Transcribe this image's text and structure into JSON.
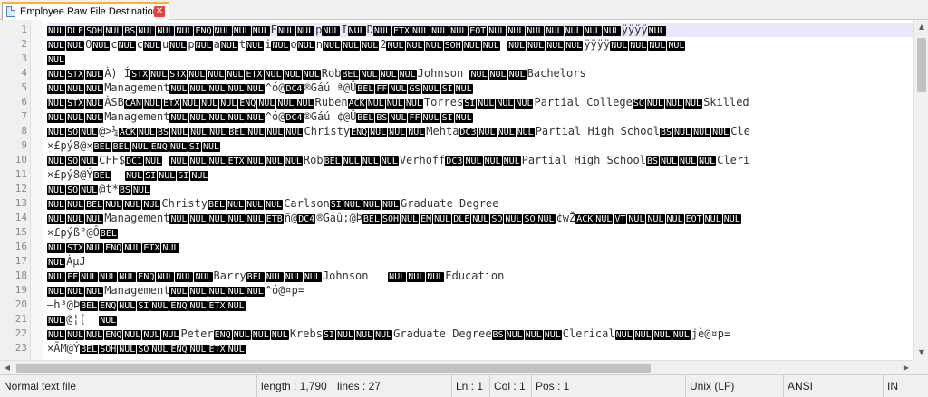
{
  "tab": {
    "title": "Employee Raw File Destination",
    "icon": "file-icon",
    "close_icon": "close-icon"
  },
  "editor": {
    "line_numbers": [
      "1",
      "2",
      "3",
      "4",
      "5",
      "6",
      "7",
      "8",
      "9",
      "10",
      "11",
      "12",
      "13",
      "14",
      "15",
      "16",
      "17",
      "18",
      "19",
      "20",
      "21",
      "22",
      "23"
    ],
    "lines": [
      [
        {
          "c": "NUL"
        },
        {
          "c": "DLE"
        },
        {
          "c": "SOH"
        },
        {
          "c": "NUL"
        },
        {
          "c": "BS"
        },
        {
          "c": "NUL"
        },
        {
          "c": "NUL"
        },
        {
          "c": "NUL"
        },
        {
          "c": "ENQ"
        },
        {
          "c": "NUL"
        },
        {
          "c": "NUL"
        },
        {
          "c": "NUL"
        },
        {
          "t": "E"
        },
        {
          "c": "NUL"
        },
        {
          "c": "NUL"
        },
        {
          "t": "p"
        },
        {
          "c": "NUL"
        },
        {
          "t": "I"
        },
        {
          "c": "NUL"
        },
        {
          "t": "D"
        },
        {
          "c": "NUL"
        },
        {
          "c": "ETX"
        },
        {
          "c": "NUL"
        },
        {
          "c": "NUL"
        },
        {
          "c": "NUL"
        },
        {
          "c": "EOT"
        },
        {
          "c": "NUL"
        },
        {
          "c": "NUL"
        },
        {
          "c": "NUL"
        },
        {
          "c": "NUL"
        },
        {
          "c": "NUL"
        },
        {
          "c": "NUL"
        },
        {
          "c": "NUL"
        },
        {
          "t": "ÿÿÿÿ"
        },
        {
          "c": "NUL"
        }
      ],
      [
        {
          "c": "NUL"
        },
        {
          "c": "NUL"
        },
        {
          "t": "O"
        },
        {
          "c": "NUL"
        },
        {
          "t": "c"
        },
        {
          "c": "NUL"
        },
        {
          "t": "c"
        },
        {
          "c": "NUL"
        },
        {
          "t": "u"
        },
        {
          "c": "NUL"
        },
        {
          "t": "p"
        },
        {
          "c": "NUL"
        },
        {
          "t": "a"
        },
        {
          "c": "NUL"
        },
        {
          "t": "t"
        },
        {
          "c": "NUL"
        },
        {
          "t": "i"
        },
        {
          "c": "NUL"
        },
        {
          "t": "o"
        },
        {
          "c": "NUL"
        },
        {
          "t": "n"
        },
        {
          "c": "NUL"
        },
        {
          "c": "NUL"
        },
        {
          "c": "NUL"
        },
        {
          "t": "2"
        },
        {
          "c": "NUL"
        },
        {
          "c": "NUL"
        },
        {
          "c": "NUL"
        },
        {
          "c": "SOH"
        },
        {
          "c": "NUL"
        },
        {
          "c": "NUL"
        },
        {
          "t": " "
        },
        {
          "c": "NUL"
        },
        {
          "c": "NUL"
        },
        {
          "c": "NUL"
        },
        {
          "c": "NUL"
        },
        {
          "t": "ÿÿÿÿ"
        },
        {
          "c": "NUL"
        },
        {
          "c": "NUL"
        },
        {
          "c": "NUL"
        },
        {
          "c": "NUL"
        }
      ],
      [
        {
          "c": "NUL"
        }
      ],
      [
        {
          "c": "NUL"
        },
        {
          "c": "STX"
        },
        {
          "c": "NUL"
        },
        {
          "t": "À) Í"
        },
        {
          "c": "STX"
        },
        {
          "c": "NUL"
        },
        {
          "c": "STX"
        },
        {
          "c": "NUL"
        },
        {
          "c": "NUL"
        },
        {
          "c": "NUL"
        },
        {
          "c": "ETX"
        },
        {
          "c": "NUL"
        },
        {
          "c": "NUL"
        },
        {
          "c": "NUL"
        },
        {
          "t": "Rob"
        },
        {
          "c": "BEL"
        },
        {
          "c": "NUL"
        },
        {
          "c": "NUL"
        },
        {
          "c": "NUL"
        },
        {
          "t": "Johnson "
        },
        {
          "c": "NUL"
        },
        {
          "c": "NUL"
        },
        {
          "c": "NUL"
        },
        {
          "t": "Bachelors"
        }
      ],
      [
        {
          "c": "NUL"
        },
        {
          "c": "NUL"
        },
        {
          "c": "NUL"
        },
        {
          "t": "Management"
        },
        {
          "c": "NUL"
        },
        {
          "c": "NUL"
        },
        {
          "c": "NUL"
        },
        {
          "c": "NUL"
        },
        {
          "c": "NUL"
        },
        {
          "t": "^ó@"
        },
        {
          "c": "DC4"
        },
        {
          "t": "®Gáú ª@Û"
        },
        {
          "c": "BEL"
        },
        {
          "c": "FF"
        },
        {
          "c": "NUL"
        },
        {
          "c": "GS"
        },
        {
          "c": "NUL"
        },
        {
          "c": "SI"
        },
        {
          "c": "NUL"
        }
      ],
      [
        {
          "c": "NUL"
        },
        {
          "c": "STX"
        },
        {
          "c": "NUL"
        },
        {
          "t": "ÀSB"
        },
        {
          "c": "CAN"
        },
        {
          "c": "NUL"
        },
        {
          "c": "ETX"
        },
        {
          "c": "NUL"
        },
        {
          "c": "NUL"
        },
        {
          "c": "NUL"
        },
        {
          "c": "ENQ"
        },
        {
          "c": "NUL"
        },
        {
          "c": "NUL"
        },
        {
          "c": "NUL"
        },
        {
          "t": "Ruben"
        },
        {
          "c": "ACK"
        },
        {
          "c": "NUL"
        },
        {
          "c": "NUL"
        },
        {
          "c": "NUL"
        },
        {
          "t": "Torres"
        },
        {
          "c": "SI"
        },
        {
          "c": "NUL"
        },
        {
          "c": "NUL"
        },
        {
          "c": "NUL"
        },
        {
          "t": "Partial College"
        },
        {
          "c": "SO"
        },
        {
          "c": "NUL"
        },
        {
          "c": "NUL"
        },
        {
          "c": "NUL"
        },
        {
          "t": "Skilled"
        }
      ],
      [
        {
          "c": "NUL"
        },
        {
          "c": "NUL"
        },
        {
          "c": "NUL"
        },
        {
          "t": "Management"
        },
        {
          "c": "NUL"
        },
        {
          "c": "NUL"
        },
        {
          "c": "NUL"
        },
        {
          "c": "NUL"
        },
        {
          "c": "NUL"
        },
        {
          "t": "^ó@"
        },
        {
          "c": "DC4"
        },
        {
          "t": "®Gáú ¢@Û"
        },
        {
          "c": "BEL"
        },
        {
          "c": "BS"
        },
        {
          "c": "NUL"
        },
        {
          "c": "FF"
        },
        {
          "c": "NUL"
        },
        {
          "c": "SI"
        },
        {
          "c": "NUL"
        }
      ],
      [
        {
          "c": "NUL"
        },
        {
          "c": "SO"
        },
        {
          "c": "NUL"
        },
        {
          "t": "@>¼"
        },
        {
          "c": "ACK"
        },
        {
          "c": "NUL"
        },
        {
          "c": "BS"
        },
        {
          "c": "NUL"
        },
        {
          "c": "NUL"
        },
        {
          "c": "NUL"
        },
        {
          "c": "BEL"
        },
        {
          "c": "NUL"
        },
        {
          "c": "NUL"
        },
        {
          "c": "NUL"
        },
        {
          "t": "Christy"
        },
        {
          "c": "ENQ"
        },
        {
          "c": "NUL"
        },
        {
          "c": "NUL"
        },
        {
          "c": "NUL"
        },
        {
          "t": "Mehta"
        },
        {
          "c": "DC3"
        },
        {
          "c": "NUL"
        },
        {
          "c": "NUL"
        },
        {
          "c": "NUL"
        },
        {
          "t": "Partial High School"
        },
        {
          "c": "BS"
        },
        {
          "c": "NUL"
        },
        {
          "c": "NUL"
        },
        {
          "c": "NUL"
        },
        {
          "t": "Cle"
        }
      ],
      [
        {
          "t": "×£pý8@×"
        },
        {
          "c": "BEL"
        },
        {
          "c": "BEL"
        },
        {
          "c": "NUL"
        },
        {
          "c": "ENQ"
        },
        {
          "c": "NUL"
        },
        {
          "c": "SI"
        },
        {
          "c": "NUL"
        }
      ],
      [
        {
          "c": "NUL"
        },
        {
          "c": "SO"
        },
        {
          "c": "NUL"
        },
        {
          "t": "CFF$"
        },
        {
          "c": "DC1"
        },
        {
          "c": "NUL"
        },
        {
          "t": " "
        },
        {
          "c": "NUL"
        },
        {
          "c": "NUL"
        },
        {
          "c": "NUL"
        },
        {
          "c": "ETX"
        },
        {
          "c": "NUL"
        },
        {
          "c": "NUL"
        },
        {
          "c": "NUL"
        },
        {
          "t": "Rob"
        },
        {
          "c": "BEL"
        },
        {
          "c": "NUL"
        },
        {
          "c": "NUL"
        },
        {
          "c": "NUL"
        },
        {
          "t": "Verhoff"
        },
        {
          "c": "DC3"
        },
        {
          "c": "NUL"
        },
        {
          "c": "NUL"
        },
        {
          "c": "NUL"
        },
        {
          "t": "Partial High School"
        },
        {
          "c": "BS"
        },
        {
          "c": "NUL"
        },
        {
          "c": "NUL"
        },
        {
          "c": "NUL"
        },
        {
          "t": "Cleri"
        }
      ],
      [
        {
          "t": "×£pý8@Ý"
        },
        {
          "c": "BEL"
        },
        {
          "t": "  "
        },
        {
          "c": "NUL"
        },
        {
          "c": "SI"
        },
        {
          "c": "NUL"
        },
        {
          "c": "SI"
        },
        {
          "c": "NUL"
        }
      ],
      [
        {
          "c": "NUL"
        },
        {
          "c": "SO"
        },
        {
          "c": "NUL"
        },
        {
          "t": "@t*"
        },
        {
          "c": "BS"
        },
        {
          "c": "NUL"
        }
      ],
      [
        {
          "c": "NUL"
        },
        {
          "c": "NUL"
        },
        {
          "c": "BEL"
        },
        {
          "c": "NUL"
        },
        {
          "c": "NUL"
        },
        {
          "c": "NUL"
        },
        {
          "t": "Christy"
        },
        {
          "c": "BEL"
        },
        {
          "c": "NUL"
        },
        {
          "c": "NUL"
        },
        {
          "c": "NUL"
        },
        {
          "t": "Carlson"
        },
        {
          "c": "SI"
        },
        {
          "c": "NUL"
        },
        {
          "c": "NUL"
        },
        {
          "c": "NUL"
        },
        {
          "t": "Graduate Degree"
        }
      ],
      [
        {
          "c": "NUL"
        },
        {
          "c": "NUL"
        },
        {
          "c": "NUL"
        },
        {
          "t": "Management"
        },
        {
          "c": "NUL"
        },
        {
          "c": "NUL"
        },
        {
          "c": "NUL"
        },
        {
          "c": "NUL"
        },
        {
          "c": "NUL"
        },
        {
          "c": "ETB"
        },
        {
          "t": "ñ@"
        },
        {
          "c": "DC4"
        },
        {
          "t": "®Gáû;@Þ"
        },
        {
          "c": "BEL"
        },
        {
          "c": "SOH"
        },
        {
          "c": "NUL"
        },
        {
          "c": "EM"
        },
        {
          "c": "NUL"
        },
        {
          "c": "DLE"
        },
        {
          "c": "NUL"
        },
        {
          "c": "SO"
        },
        {
          "c": "NUL"
        },
        {
          "c": "SO"
        },
        {
          "c": "NUL"
        },
        {
          "t": "¢wŽ"
        },
        {
          "c": "ACK"
        },
        {
          "c": "NUL"
        },
        {
          "c": "VT"
        },
        {
          "c": "NUL"
        },
        {
          "c": "NUL"
        },
        {
          "c": "NUL"
        },
        {
          "c": "EOT"
        },
        {
          "c": "NUL"
        },
        {
          "c": "NUL"
        }
      ],
      [
        {
          "t": "×£pýß°@Ô"
        },
        {
          "c": "BEL"
        }
      ],
      [
        {
          "c": "NUL"
        },
        {
          "c": "STX"
        },
        {
          "c": "NUL"
        },
        {
          "c": "ENQ"
        },
        {
          "c": "NUL"
        },
        {
          "c": "ETX"
        },
        {
          "c": "NUL"
        }
      ],
      [
        {
          "c": "NUL"
        },
        {
          "t": "ÀµJ"
        }
      ],
      [
        {
          "c": "NUL"
        },
        {
          "c": "FF"
        },
        {
          "c": "NUL"
        },
        {
          "c": "NUL"
        },
        {
          "c": "NUL"
        },
        {
          "c": "ENQ"
        },
        {
          "c": "NUL"
        },
        {
          "c": "NUL"
        },
        {
          "c": "NUL"
        },
        {
          "t": "Barry"
        },
        {
          "c": "BEL"
        },
        {
          "c": "NUL"
        },
        {
          "c": "NUL"
        },
        {
          "c": "NUL"
        },
        {
          "t": "Johnson   "
        },
        {
          "c": "NUL"
        },
        {
          "c": "NUL"
        },
        {
          "c": "NUL"
        },
        {
          "t": "Education"
        }
      ],
      [
        {
          "c": "NUL"
        },
        {
          "c": "NUL"
        },
        {
          "c": "NUL"
        },
        {
          "t": "Management"
        },
        {
          "c": "NUL"
        },
        {
          "c": "NUL"
        },
        {
          "c": "NUL"
        },
        {
          "c": "NUL"
        },
        {
          "c": "NUL"
        },
        {
          "t": "^ó@¤p="
        }
      ],
      [
        {
          "t": "—h³@Þ"
        },
        {
          "c": "BEL"
        },
        {
          "c": "ENQ"
        },
        {
          "c": "NUL"
        },
        {
          "c": "SI"
        },
        {
          "c": "NUL"
        },
        {
          "c": "ENQ"
        },
        {
          "c": "NUL"
        },
        {
          "c": "ETX"
        },
        {
          "c": "NUL"
        }
      ],
      [
        {
          "c": "NUL"
        },
        {
          "t": "@¦[  "
        },
        {
          "c": "NUL"
        }
      ],
      [
        {
          "c": "NUL"
        },
        {
          "c": "NUL"
        },
        {
          "c": "NUL"
        },
        {
          "c": "ENQ"
        },
        {
          "c": "NUL"
        },
        {
          "c": "NUL"
        },
        {
          "c": "NUL"
        },
        {
          "t": "Peter"
        },
        {
          "c": "ENQ"
        },
        {
          "c": "NUL"
        },
        {
          "c": "NUL"
        },
        {
          "c": "NUL"
        },
        {
          "t": "Krebs"
        },
        {
          "c": "SI"
        },
        {
          "c": "NUL"
        },
        {
          "c": "NUL"
        },
        {
          "c": "NUL"
        },
        {
          "t": "Graduate Degree"
        },
        {
          "c": "BS"
        },
        {
          "c": "NUL"
        },
        {
          "c": "NUL"
        },
        {
          "c": "NUL"
        },
        {
          "t": "Clerical"
        },
        {
          "c": "NUL"
        },
        {
          "c": "NUL"
        },
        {
          "c": "NUL"
        },
        {
          "c": "NUL"
        },
        {
          "t": "jè@¤p="
        }
      ],
      [
        {
          "t": "×ÃM@Ý"
        },
        {
          "c": "BEL"
        },
        {
          "c": "SOH"
        },
        {
          "c": "NUL"
        },
        {
          "c": "SO"
        },
        {
          "c": "NUL"
        },
        {
          "c": "ENQ"
        },
        {
          "c": "NUL"
        },
        {
          "c": "ETX"
        },
        {
          "c": "NUL"
        }
      ]
    ]
  },
  "scrollbars": {
    "up_arrow": "▲",
    "down_arrow": "▼",
    "left_arrow": "◀",
    "right_arrow": "▶"
  },
  "status": {
    "file_type": "Normal text file",
    "length": "length : 1,790",
    "lines": "lines : 27",
    "ln": "Ln : 1",
    "col": "Col : 1",
    "pos": "Pos : 1",
    "eol": "Unix (LF)",
    "encoding": "ANSI",
    "mode": "IN"
  }
}
